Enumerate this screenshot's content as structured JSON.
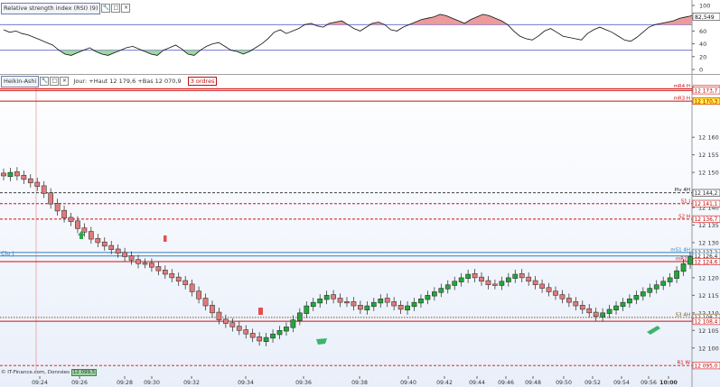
{
  "rsi": {
    "title": "Relative strength index (RSI) (9)",
    "levels": [
      "100",
      "80",
      "60",
      "40",
      "20",
      "0"
    ],
    "current_value": "82,549",
    "upper_line": 70,
    "lower_line": 30
  },
  "price": {
    "title": "Heikin-Ashi",
    "info": "Jour: +Haut 12 179,6 +Bas 12 070,9",
    "orders": "3 ordres",
    "y_ticks": [
      "12 170",
      "12 160",
      "12 155",
      "12 150",
      "12 140",
      "12 135",
      "12 130",
      "12 120",
      "12 115",
      "12 110",
      "12 105",
      "12 100"
    ],
    "x_ticks": [
      "09:24",
      "09:26",
      "09:28",
      "09:30",
      "09:32",
      "09:34",
      "09:36",
      "09:38",
      "09:40",
      "09:42",
      "09:44",
      "09:46",
      "09:48",
      "09:50",
      "09:52",
      "09:54",
      "09:56",
      "10:00"
    ],
    "footer": "© IT-Finance.com, Données",
    "footer_badge": "12 099,5",
    "left_label": "Clo J",
    "levels": [
      {
        "name": "mR4 H",
        "value": "12 173,8",
        "price": 12173.8,
        "style": "solid",
        "color": "#d01010"
      },
      {
        "name": "",
        "value": "12 173,7",
        "price": 12173.3,
        "style": "solid",
        "color": "#d01010"
      },
      {
        "name": "mR3 H",
        "value": "12 170,3",
        "price": 12170.3,
        "style": "solid",
        "color": "#d01010",
        "highlight": true
      },
      {
        "name": "Piv 4H",
        "value": "12 144,2",
        "price": 12144.2,
        "style": "dashed",
        "color": "#222222"
      },
      {
        "name": "S1 J",
        "value": "12 141,1",
        "price": 12141.1,
        "style": "dashed",
        "color": "#d01010"
      },
      {
        "name": "S2 H",
        "value": "12 136,7",
        "price": 12136.7,
        "style": "dashed",
        "color": "#d01010"
      },
      {
        "name": "mS1 4H",
        "value": "12 127,2",
        "price": 12127.2,
        "style": "solid",
        "color": "#3080c0"
      },
      {
        "name": "",
        "value": "12 126,4",
        "price": 12126.2,
        "style": "solid",
        "color": "#3080c0"
      },
      {
        "name": "mR2 J",
        "value": "12 124,6",
        "price": 12124.6,
        "style": "solid",
        "color": "#d01010"
      },
      {
        "name": "S3 4H",
        "value": "12 108,7",
        "price": 12108.7,
        "style": "dotted",
        "color": "#7a5a20"
      },
      {
        "name": "",
        "value": "12 108,4",
        "price": 12107.6,
        "style": "solid",
        "color": "#d01010"
      },
      {
        "name": "R1 W",
        "value": "12 095,0",
        "price": 12095.0,
        "style": "dashed",
        "color": "#d01010"
      }
    ]
  },
  "chart_data": {
    "type": "candlestick",
    "price_range": [
      12093,
      12177
    ],
    "x_range": [
      "09:23",
      "10:01"
    ],
    "candles_close": [
      12149,
      12150,
      12149,
      12148,
      12147,
      12146,
      12144,
      12141,
      12139,
      12137,
      12136,
      12134,
      12133,
      12131,
      12130,
      12129,
      12128,
      12127,
      12126,
      12125,
      12124,
      12124,
      12123,
      12122,
      12121,
      12120,
      12119,
      12118,
      12116,
      12114,
      12112,
      12110,
      12108,
      12107,
      12106,
      12105,
      12104,
      12103,
      12102,
      12103,
      12104,
      12105,
      12106,
      12108,
      12110,
      12112,
      12113,
      12114,
      12115,
      12114,
      12113,
      12113,
      12112,
      12111,
      12112,
      12113,
      12114,
      12113,
      12112,
      12111,
      12112,
      12113,
      12114,
      12115,
      12116,
      12117,
      12118,
      12119,
      12120,
      12121,
      12120,
      12119,
      12118,
      12118,
      12119,
      12120,
      12121,
      12120,
      12119,
      12118,
      12117,
      12116,
      12115,
      12114,
      12113,
      12112,
      12111,
      12110,
      12109,
      12110,
      12111,
      12112,
      12113,
      12114,
      12115,
      12116,
      12117,
      12118,
      12119,
      12120,
      12122,
      12124,
      12126
    ],
    "rsi_values": [
      62,
      58,
      60,
      56,
      54,
      50,
      46,
      42,
      38,
      30,
      24,
      22,
      26,
      30,
      34,
      28,
      24,
      22,
      26,
      30,
      34,
      36,
      32,
      28,
      24,
      22,
      30,
      34,
      38,
      32,
      24,
      22,
      30,
      36,
      40,
      42,
      36,
      30,
      28,
      24,
      28,
      34,
      40,
      48,
      58,
      62,
      56,
      60,
      64,
      70,
      72,
      68,
      66,
      72,
      74,
      76,
      70,
      64,
      60,
      66,
      72,
      74,
      70,
      62,
      60,
      66,
      70,
      74,
      78,
      80,
      82,
      86,
      84,
      80,
      76,
      72,
      78,
      82,
      86,
      84,
      80,
      76,
      70,
      60,
      52,
      48,
      46,
      52,
      60,
      64,
      58,
      52,
      50,
      48,
      46,
      56,
      62,
      66,
      62,
      58,
      52,
      46,
      44,
      50,
      58,
      66,
      70,
      72,
      74,
      76,
      80,
      82,
      84
    ]
  }
}
